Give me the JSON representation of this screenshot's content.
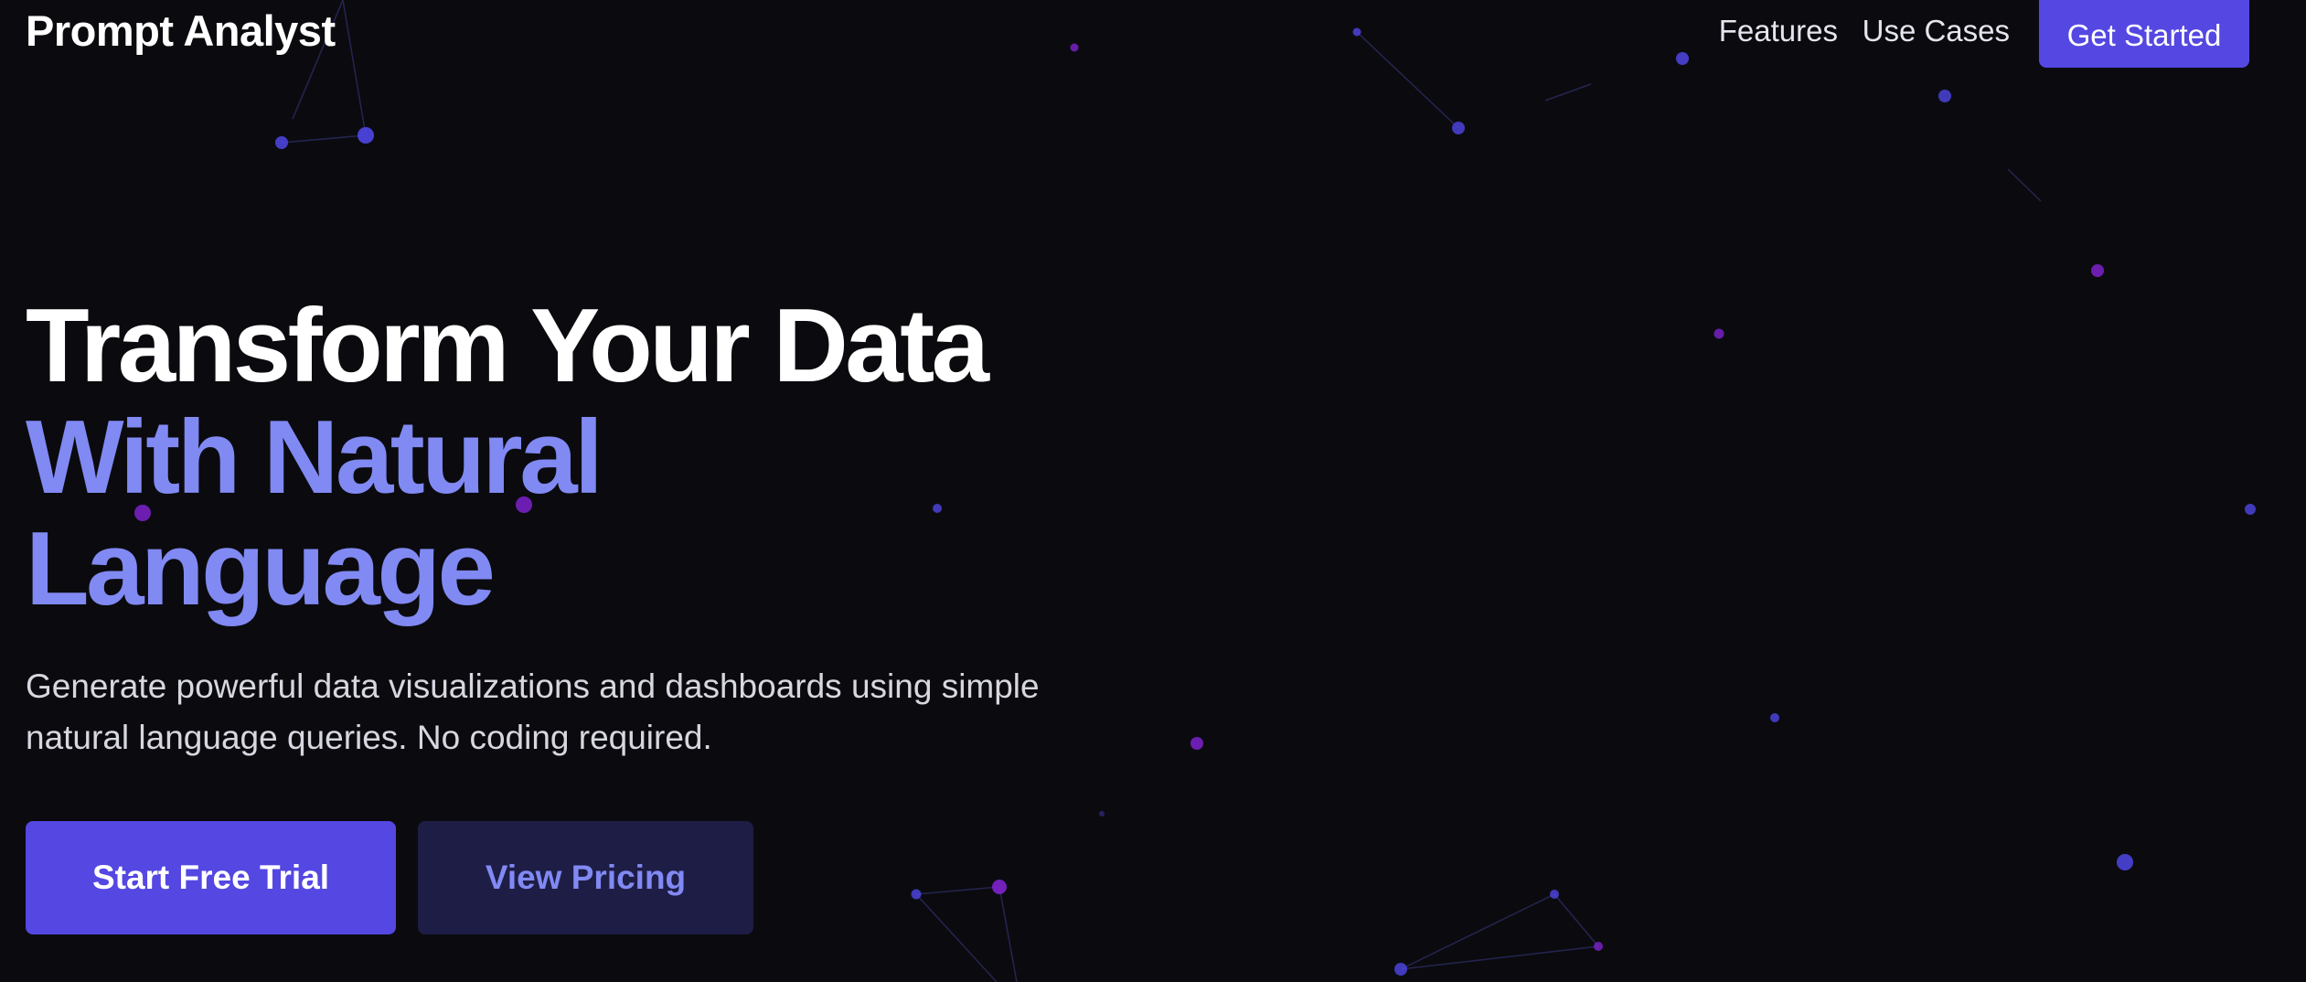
{
  "colors": {
    "background": "#0b0b0f",
    "accent": "#5447e2",
    "accent_text": "#8189f3",
    "secondary_button_bg": "#1e1d45",
    "particle_blue": "#5b5bf0",
    "particle_purple": "#9333ea"
  },
  "nav": {
    "brand": "Prompt Analyst",
    "links": [
      {
        "label": "Features"
      },
      {
        "label": "Use Cases"
      }
    ],
    "cta_label": "Get Started"
  },
  "hero": {
    "headline_line1": "Transform Your Data",
    "headline_line2": "With Natural",
    "headline_line3": "Language",
    "subtitle": "Generate powerful data visualizations and dashboards using simple natural language queries. No coding required.",
    "primary_button": "Start Free Trial",
    "secondary_button": "View Pricing"
  },
  "background": {
    "decoration": "particle-network"
  }
}
